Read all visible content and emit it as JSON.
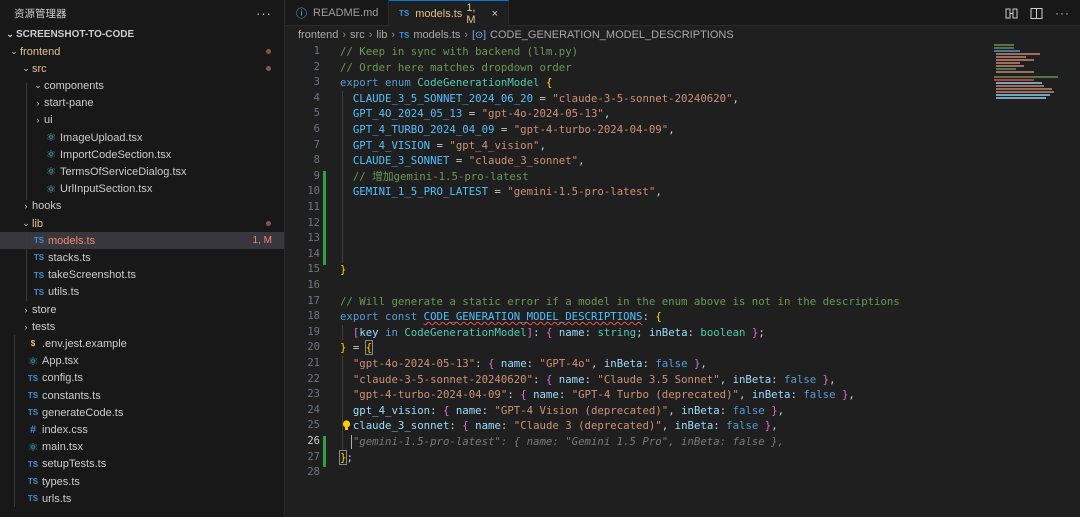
{
  "sidebar": {
    "title": "资源管理器",
    "more": "···",
    "root": "SCREENSHOT-TO-CODE",
    "items": [
      {
        "label": "frontend",
        "status": ""
      },
      {
        "label": "src",
        "status": ""
      },
      {
        "label": "components",
        "status": ""
      },
      {
        "label": "start-pane",
        "status": ""
      },
      {
        "label": "ui",
        "status": ""
      },
      {
        "label": "ImageUpload.tsx",
        "status": ""
      },
      {
        "label": "ImportCodeSection.tsx",
        "status": ""
      },
      {
        "label": "TermsOfServiceDialog.tsx",
        "status": ""
      },
      {
        "label": "UrlInputSection.tsx",
        "status": ""
      },
      {
        "label": "hooks",
        "status": ""
      },
      {
        "label": "lib",
        "status": ""
      },
      {
        "label": "models.ts",
        "status": "1, M"
      },
      {
        "label": "stacks.ts",
        "status": ""
      },
      {
        "label": "takeScreenshot.ts",
        "status": ""
      },
      {
        "label": "utils.ts",
        "status": ""
      },
      {
        "label": "store",
        "status": ""
      },
      {
        "label": "tests",
        "status": ""
      },
      {
        "label": ".env.jest.example",
        "status": ""
      },
      {
        "label": "App.tsx",
        "status": ""
      },
      {
        "label": "config.ts",
        "status": ""
      },
      {
        "label": "constants.ts",
        "status": ""
      },
      {
        "label": "generateCode.ts",
        "status": ""
      },
      {
        "label": "index.css",
        "status": ""
      },
      {
        "label": "main.tsx",
        "status": ""
      },
      {
        "label": "setupTests.ts",
        "status": ""
      },
      {
        "label": "types.ts",
        "status": ""
      },
      {
        "label": "urls.ts",
        "status": ""
      }
    ],
    "icon_ts": "TS",
    "icon_css": "#",
    "icon_env": "$"
  },
  "tabs": [
    {
      "label": "README.md",
      "icon": "ⓘ",
      "status": ""
    },
    {
      "label": "models.ts",
      "icon": "TS",
      "status": "1, M",
      "close": "×"
    }
  ],
  "breadcrumb": {
    "parts": [
      "frontend",
      "src",
      "lib",
      "models.ts",
      "CODE_GENERATION_MODEL_DESCRIPTIONS"
    ],
    "ts_icon": "TS"
  },
  "editor": {
    "line_numbers": [
      "1",
      "2",
      "3",
      "4",
      "5",
      "6",
      "7",
      "8",
      "9",
      "10",
      "11",
      "12",
      "13",
      "14",
      "15",
      "16",
      "17",
      "18",
      "19",
      "20",
      "21",
      "22",
      "23",
      "24",
      "25",
      "26",
      "27",
      "28"
    ],
    "current_line": "26",
    "lines": {
      "l1": "// Keep in sync with backend (llm.py)",
      "l2": "// Order here matches dropdown order",
      "export": "export",
      "enum": "enum",
      "enum_name": "CodeGenerationModel",
      "claude35_key": "CLAUDE_3_5_SONNET_2024_06_20",
      "claude35_val": "\"claude-3-5-sonnet-20240620\"",
      "gpt4o_key": "GPT_4O_2024_05_13",
      "gpt4o_val": "\"gpt-4o-2024-05-13\"",
      "gpt4t_key": "GPT_4_TURBO_2024_04_09",
      "gpt4t_val": "\"gpt-4-turbo-2024-04-09\"",
      "gpt4v_key": "GPT_4_VISION",
      "gpt4v_val": "\"gpt_4_vision\"",
      "claude3_key": "CLAUDE_3_SONNET",
      "claude3_val": "\"claude_3_sonnet\"",
      "l10": "// 增加gemini-1.5-pro-latest",
      "gemini_key": "GEMINI_1_5_PRO_LATEST",
      "gemini_val": "\"gemini-1.5-pro-latest\"",
      "l17": "// Will generate a static error if a model in the enum above is not in the descriptions",
      "const": "const",
      "desc_name": "CODE_GENERATION_MODEL_DESCRIPTIONS",
      "key": "key",
      "in": "in",
      "name_prop": "name",
      "string_t": "string",
      "inbeta_prop": "inBeta",
      "boolean_t": "boolean",
      "r21_key": "\"gpt-4o-2024-05-13\"",
      "r21_name": "\"GPT-4o\"",
      "r22_key": "\"claude-3-5-sonnet-20240620\"",
      "r22_name": "\"Claude 3.5 Sonnet\"",
      "r23_key": "\"gpt-4-turbo-2024-04-09\"",
      "r23_name": "\"GPT-4 Turbo (deprecated)\"",
      "r24_key": "gpt_4_vision",
      "r24_name": "\"GPT-4 Vision (deprecated)\"",
      "r25_key": "claude_3_sonnet",
      "r25_name": "\"Claude 3 (deprecated)\"",
      "false_v": "false",
      "ghost26": "\"gemini-1.5-pro-latest\": { name: \"Gemini 1.5 Pro\", inBeta: false },"
    }
  },
  "colors": {
    "accent": "#0078d4",
    "modified": "#e2c08d",
    "error": "#f48771",
    "added_gutter": "#2ea043"
  }
}
